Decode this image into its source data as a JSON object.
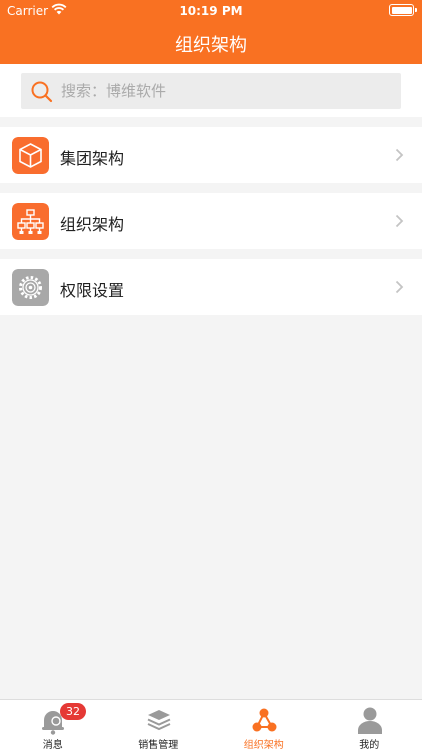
{
  "status_bar": {
    "carrier": "Carrier",
    "time": "10:19 PM"
  },
  "header": {
    "title": "组织架构"
  },
  "search": {
    "placeholder": "搜索：博维软件"
  },
  "menu": [
    {
      "label": "集团架构",
      "icon": "cube-icon",
      "color": "#f96d2e"
    },
    {
      "label": "组织架构",
      "icon": "org-chart-icon",
      "color": "#f96d2e"
    },
    {
      "label": "权限设置",
      "icon": "gear-icon",
      "color": "#a8a8a8"
    }
  ],
  "tabbar": {
    "tabs": [
      {
        "label": "消息",
        "icon": "bell-icon",
        "badge": "32"
      },
      {
        "label": "销售管理",
        "icon": "layers-icon"
      },
      {
        "label": "组织架构",
        "icon": "share-nodes-icon",
        "active": true
      },
      {
        "label": "我的",
        "icon": "person-icon"
      }
    ]
  },
  "colors": {
    "accent": "#f97122",
    "badge": "#e53935",
    "background": "#f4f4f4"
  }
}
